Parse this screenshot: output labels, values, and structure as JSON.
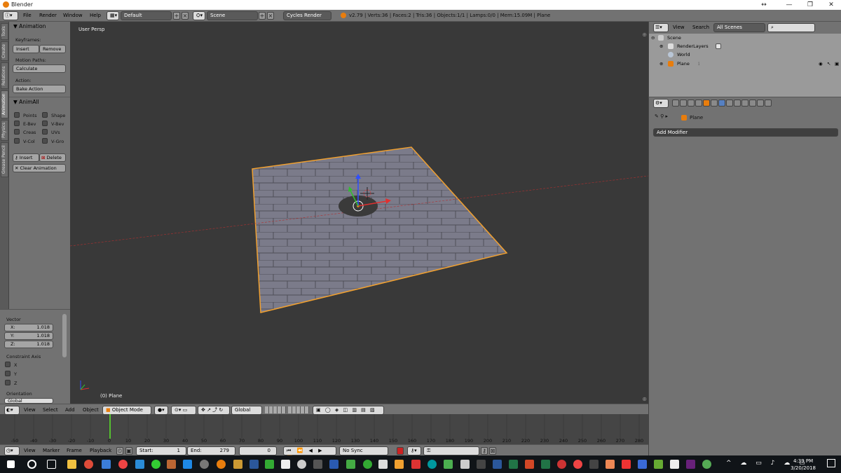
{
  "window": {
    "title": "Blender",
    "minimize": "—",
    "maximize": "❐",
    "close": "✕",
    "resize_glyph": "↔"
  },
  "infobar": {
    "menus": [
      "File",
      "Render",
      "Window",
      "Help"
    ],
    "layout": "Default",
    "scene": "Scene",
    "engine": "Cycles Render",
    "stats": "v2.79 | Verts:36 | Faces:2 | Tris:36 | Objects:1/1 | Lamps:0/0 | Mem:15.09M | Plane"
  },
  "shelf_tabs": [
    "Tools",
    "Create",
    "Relations",
    "Animation",
    "Physics",
    "Grease Pencil"
  ],
  "shelf": {
    "animation_title": "Animation",
    "keyframes_label": "Keyframes:",
    "insert": "Insert",
    "remove": "Remove",
    "motion_paths_label": "Motion Paths:",
    "calculate": "Calculate",
    "action_label": "Action:",
    "bake_action": "Bake Action",
    "animall_title": "AnimAll",
    "checks": [
      {
        "left": "Points",
        "right": "Shape"
      },
      {
        "left": "E-Bev",
        "right": "V-Bev"
      },
      {
        "left": "Creas",
        "right": "UVs"
      },
      {
        "left": "V-Col",
        "right": "V-Gro"
      }
    ],
    "insert2": "Insert",
    "delete": "Delete",
    "clear_animation": "Clear Animation"
  },
  "redo": {
    "vector_label": "Vector",
    "x": {
      "label": "X:",
      "value": "1.018"
    },
    "y": {
      "label": "Y:",
      "value": "1.018"
    },
    "z": {
      "label": "Z:",
      "value": "1.018"
    },
    "constraint_label": "Constraint Axis",
    "axes": [
      "X",
      "Y",
      "Z"
    ],
    "orientation_label": "Orientation",
    "orientation_value": "Global"
  },
  "viewport": {
    "view_label": "User Persp",
    "object_label": "(0) Plane"
  },
  "vp_header": {
    "menus": [
      "View",
      "Select",
      "Add",
      "Object"
    ],
    "mode": "Object Mode",
    "orientation": "Global"
  },
  "timeline": {
    "ticks": [
      "-50",
      "-40",
      "-30",
      "-20",
      "-10",
      "0",
      "10",
      "20",
      "30",
      "40",
      "50",
      "60",
      "70",
      "80",
      "90",
      "100",
      "110",
      "120",
      "130",
      "140",
      "150",
      "160",
      "170",
      "180",
      "190",
      "200",
      "210",
      "220",
      "230",
      "240",
      "250",
      "260",
      "270",
      "280"
    ],
    "current_frame": 0
  },
  "tl_header": {
    "menus": [
      "View",
      "Marker",
      "Frame",
      "Playback"
    ],
    "start_label": "Start:",
    "start_value": "1",
    "end_label": "End:",
    "end_value": "279",
    "frame_value": "0",
    "sync": "No Sync"
  },
  "outliner": {
    "menus": [
      "View",
      "Search"
    ],
    "filter": "All Scenes",
    "rows": [
      "Scene",
      "RenderLayers",
      "World",
      "Plane"
    ]
  },
  "properties": {
    "breadcrumb_object": "Plane",
    "add_modifier": "Add Modifier"
  },
  "taskbar": {
    "time": "4:39 PM",
    "date": "3/20/2018"
  },
  "colors": {
    "accent_orange": "#e87d0d",
    "selection_outline": "#f0a030"
  }
}
